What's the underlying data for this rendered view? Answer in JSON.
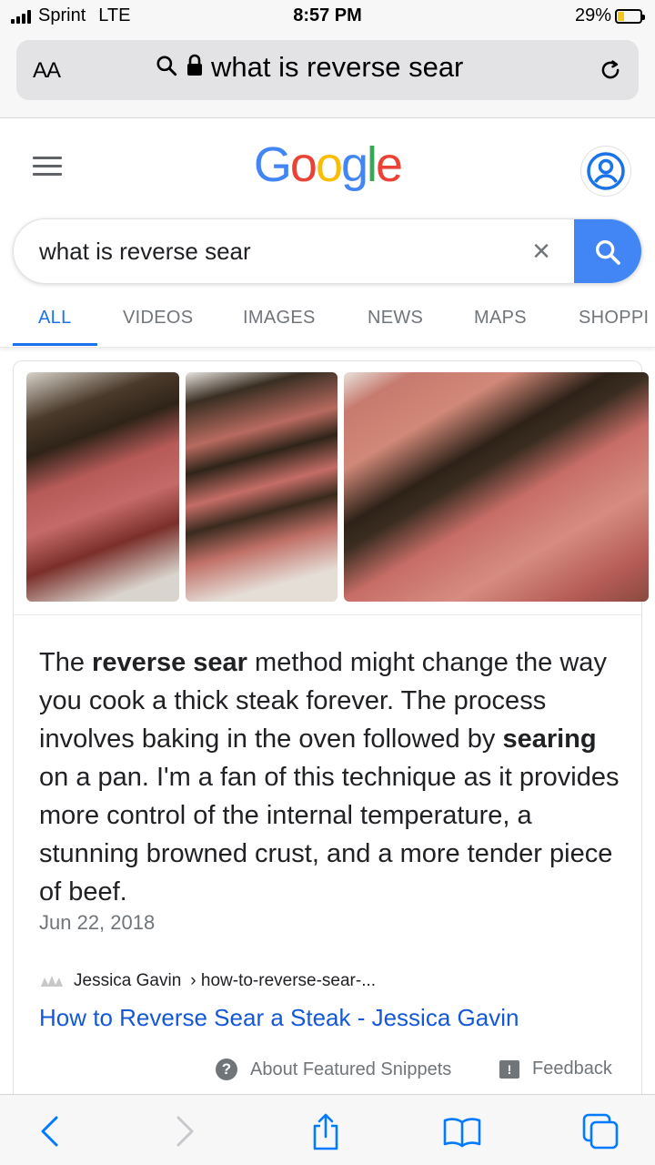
{
  "status_bar": {
    "carrier": "Sprint",
    "network": "LTE",
    "time": "8:57 PM",
    "battery_percent": "29%",
    "battery_level": 0.29
  },
  "browser": {
    "text_size_label": "AA",
    "url_text": "what is reverse sear"
  },
  "google": {
    "logo_letters": [
      {
        "char": "G",
        "color": "#4285f4"
      },
      {
        "char": "o",
        "color": "#ea4335"
      },
      {
        "char": "o",
        "color": "#fbbc05"
      },
      {
        "char": "g",
        "color": "#4285f4"
      },
      {
        "char": "l",
        "color": "#34a853"
      },
      {
        "char": "e",
        "color": "#ea4335"
      }
    ],
    "search_query": "what is reverse sear",
    "clear_symbol": "×",
    "tabs": [
      "ALL",
      "VIDEOS",
      "IMAGES",
      "NEWS",
      "MAPS",
      "SHOPPI"
    ]
  },
  "snippet": {
    "text_parts": [
      {
        "text": "The ",
        "bold": false
      },
      {
        "text": "reverse sear",
        "bold": true
      },
      {
        "text": " method might change the way you cook a thick steak forever. The process involves baking in the oven followed by ",
        "bold": false
      },
      {
        "text": "searing",
        "bold": true
      },
      {
        "text": " on a pan. I'm a fan of this technique as it provides more control of the internal temperature, a stunning browned crust, and a more tender piece of beef.",
        "bold": false
      }
    ],
    "date": "Jun 22, 2018",
    "source_site": "Jessica Gavin",
    "source_path": "› how-to-reverse-sear-...",
    "link_title": "How to Reverse Sear a Steak - Jessica Gavin",
    "about_label": "About Featured Snippets",
    "about_icon_glyph": "?",
    "feedback_label": "Feedback",
    "feedback_icon_glyph": "!"
  },
  "colors": {
    "accent_blue": "#1a73e8",
    "search_button": "#4285f4",
    "link_blue": "#1558d6",
    "safari_blue": "#007aff"
  }
}
